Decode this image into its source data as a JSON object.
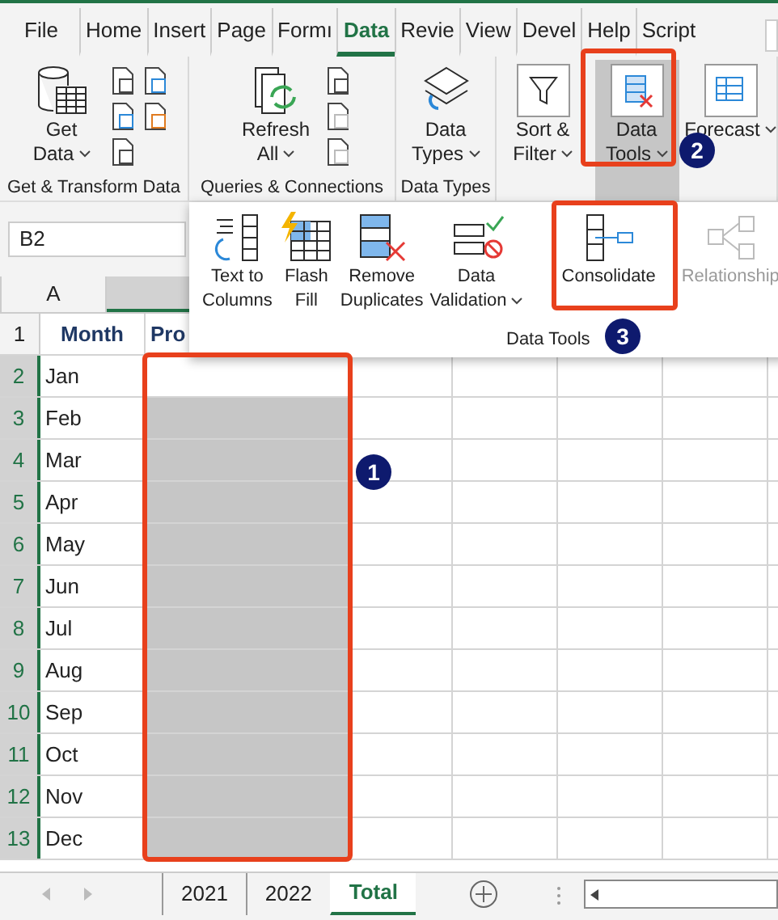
{
  "ribbon_tabs": [
    {
      "label": "File",
      "selected": false
    },
    {
      "label": "Home",
      "selected": false
    },
    {
      "label": "Insert",
      "selected": false
    },
    {
      "label": "Page",
      "selected": false
    },
    {
      "label": "Formı",
      "selected": false
    },
    {
      "label": "Data",
      "selected": true
    },
    {
      "label": "Revie",
      "selected": false
    },
    {
      "label": "View",
      "selected": false
    },
    {
      "label": "Devel",
      "selected": false
    },
    {
      "label": "Help",
      "selected": false
    },
    {
      "label": "Script",
      "selected": false
    }
  ],
  "ribbon_groups": [
    {
      "label": "Get & Transform Data",
      "buttons": [
        {
          "kind": "get-data",
          "lines": [
            "Get",
            "Data"
          ],
          "dropdown": true,
          "pressed": false
        }
      ]
    },
    {
      "label": "Queries & Connections",
      "buttons": [
        {
          "kind": "refresh",
          "lines": [
            "Refresh",
            "All"
          ],
          "dropdown": true,
          "pressed": false
        }
      ]
    },
    {
      "label": "Data Types",
      "buttons": [
        {
          "kind": "data-types",
          "lines": [
            "Data",
            "Types"
          ],
          "dropdown": true,
          "pressed": false
        }
      ]
    },
    {
      "buttons": [
        {
          "kind": "filter",
          "lines": [
            "Sort &",
            "Filter"
          ],
          "dropdown": true,
          "pressed": false
        },
        {
          "kind": "data-tools",
          "lines": [
            "Data",
            "Tools"
          ],
          "dropdown": true,
          "pressed": true
        },
        {
          "kind": "forecast",
          "lines": [
            "Forecast"
          ],
          "dropdown": true,
          "pressed": false
        }
      ]
    }
  ],
  "name_box": "B2",
  "data_tools_menu": {
    "label": "Data Tools",
    "items": [
      {
        "kind": "text-to-columns",
        "lines": [
          "Text to",
          "Columns"
        ],
        "dropdown": false,
        "disabled": false
      },
      {
        "kind": "flash-fill",
        "lines": [
          "Flash",
          "Fill"
        ],
        "dropdown": false,
        "disabled": false
      },
      {
        "kind": "remove-duplicates",
        "lines": [
          "Remove",
          "Duplicates"
        ],
        "dropdown": false,
        "disabled": false
      },
      {
        "kind": "data-validation",
        "lines": [
          "Data",
          "Validation"
        ],
        "dropdown": true,
        "disabled": false
      },
      {
        "kind": "consolidate",
        "lines": [
          "Consolidate"
        ],
        "dropdown": false,
        "disabled": false
      },
      {
        "kind": "relationships",
        "lines": [
          "Relationship"
        ],
        "dropdown": false,
        "disabled": true
      }
    ]
  },
  "columns": [
    "A"
  ],
  "rows": [
    {
      "number": "1",
      "cells": [
        "Month",
        "Pro"
      ],
      "header": true,
      "selected": false
    },
    {
      "number": "2",
      "cells": [
        "Jan"
      ],
      "header": false,
      "selected": true
    },
    {
      "number": "3",
      "cells": [
        "Feb"
      ],
      "header": false,
      "selected": true
    },
    {
      "number": "4",
      "cells": [
        "Mar"
      ],
      "header": false,
      "selected": true
    },
    {
      "number": "5",
      "cells": [
        "Apr"
      ],
      "header": false,
      "selected": true
    },
    {
      "number": "6",
      "cells": [
        "May"
      ],
      "header": false,
      "selected": true
    },
    {
      "number": "7",
      "cells": [
        "Jun"
      ],
      "header": false,
      "selected": true
    },
    {
      "number": "8",
      "cells": [
        "Jul"
      ],
      "header": false,
      "selected": true
    },
    {
      "number": "9",
      "cells": [
        "Aug"
      ],
      "header": false,
      "selected": true
    },
    {
      "number": "10",
      "cells": [
        "Sep"
      ],
      "header": false,
      "selected": true
    },
    {
      "number": "11",
      "cells": [
        "Oct"
      ],
      "header": false,
      "selected": true
    },
    {
      "number": "12",
      "cells": [
        "Nov"
      ],
      "header": false,
      "selected": true
    },
    {
      "number": "13",
      "cells": [
        "Dec"
      ],
      "header": false,
      "selected": true
    }
  ],
  "sheet_tabs": [
    {
      "label": "2021",
      "selected": false
    },
    {
      "label": "2022",
      "selected": false
    },
    {
      "label": "Total",
      "selected": true
    }
  ],
  "steps": [
    "1",
    "2",
    "3"
  ]
}
